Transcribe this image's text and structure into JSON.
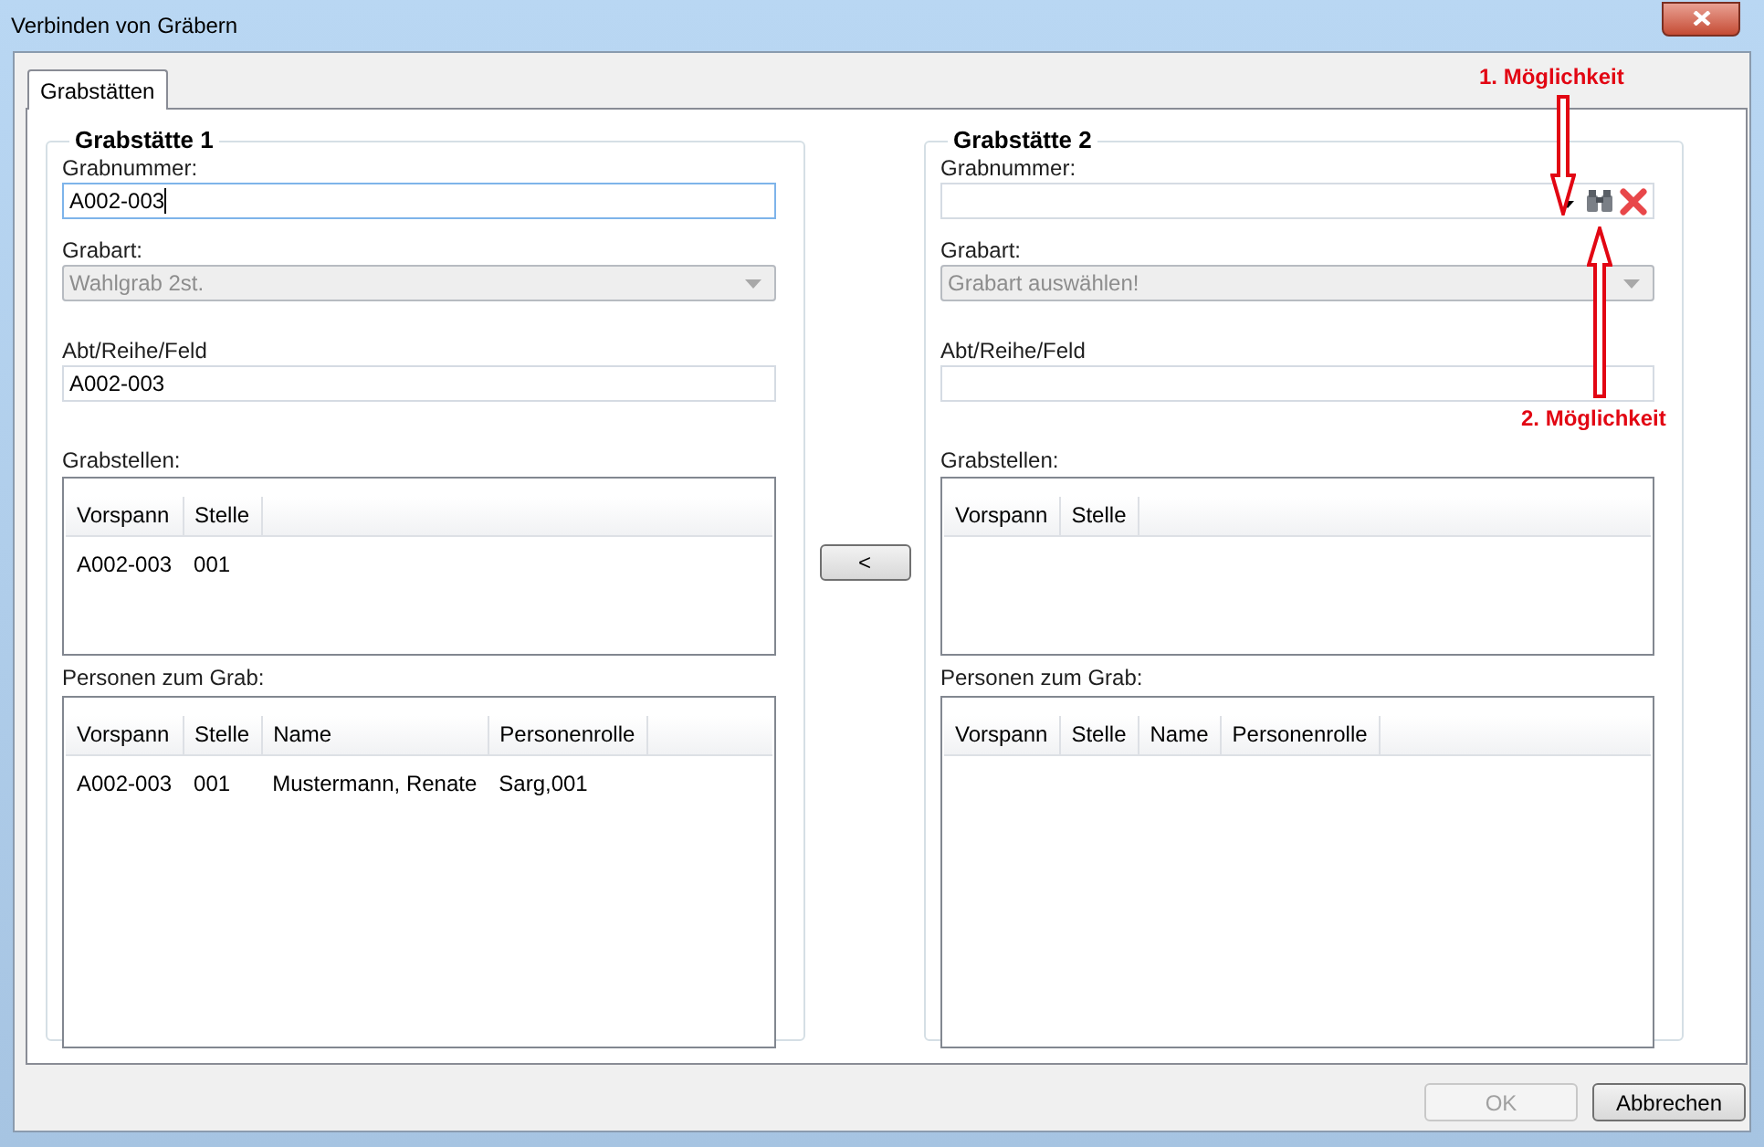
{
  "window": {
    "title": "Verbinden von Gräbern"
  },
  "tabs": [
    {
      "label": "Grabstätten",
      "selected": true
    }
  ],
  "groups": [
    {
      "title": "Grabstätte 1",
      "grabnummer": {
        "label": "Grabnummer:",
        "value": "A002-003",
        "focused": true,
        "kind": "plain"
      },
      "grabart": {
        "label": "Grabart:",
        "value": "Wahlgrab 2st.",
        "disabled": true
      },
      "abt": {
        "label": "Abt/Reihe/Feld",
        "value": "A002-003"
      },
      "grabstellen": {
        "label": "Grabstellen:",
        "columns": [
          "Vorspann",
          "Stelle"
        ],
        "rows": [
          [
            "A002-003",
            "001"
          ]
        ]
      },
      "personen": {
        "label": "Personen zum Grab:",
        "columns": [
          "Vorspann",
          "Stelle",
          "Name",
          "Personenrolle"
        ],
        "rows": [
          [
            "A002-003",
            "001",
            "Mustermann, Renate",
            "Sarg,001"
          ]
        ]
      }
    },
    {
      "title": "Grabstätte 2",
      "grabnummer": {
        "label": "Grabnummer:",
        "focused": false,
        "kind": "lookup"
      },
      "grabart": {
        "label": "Grabart:",
        "value": "Grabart auswählen!",
        "disabled": true
      },
      "abt": {
        "label": "Abt/Reihe/Feld"
      },
      "grabstellen": {
        "label": "Grabstellen:",
        "columns": [
          "Vorspann",
          "Stelle"
        ]
      },
      "personen": {
        "label": "Personen zum Grab:",
        "columns": [
          "Vorspann",
          "Stelle",
          "Name",
          "Personenrolle"
        ]
      }
    }
  ],
  "transfer_button": {
    "label": "<"
  },
  "buttons": [
    {
      "label": "OK",
      "disabled": true
    },
    {
      "label": "Abbrechen",
      "disabled": false
    }
  ],
  "annotations": [
    {
      "text": "1. Möglichkeit",
      "kind": "down"
    },
    {
      "text": "2. Möglichkeit",
      "kind": "up"
    }
  ]
}
